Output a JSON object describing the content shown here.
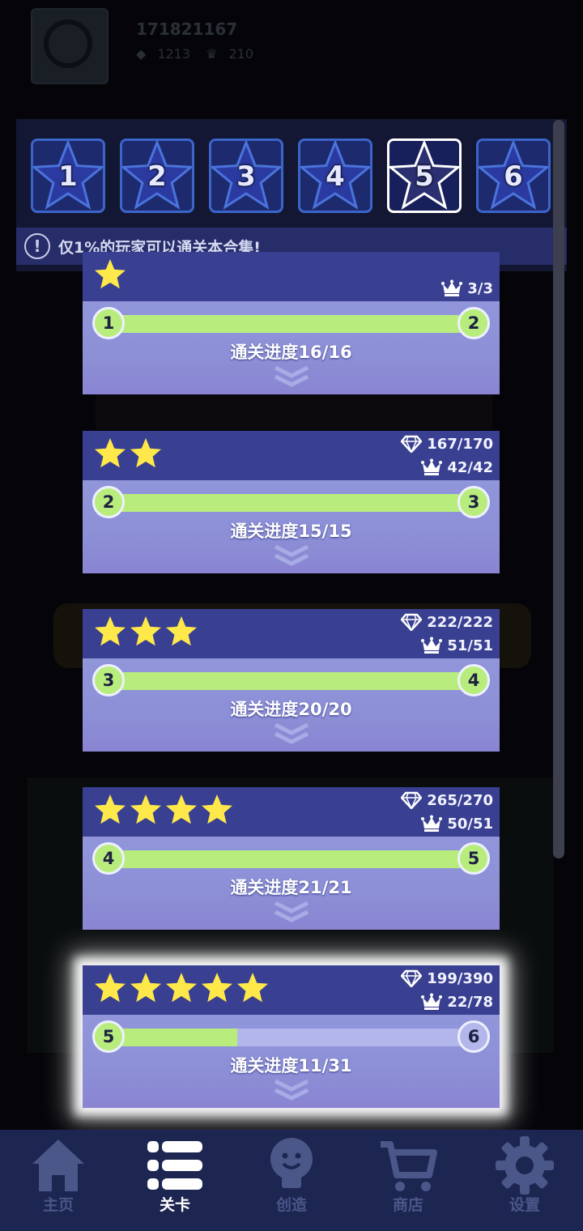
{
  "background": {
    "user_id": "171821167",
    "gems": "1213",
    "crowns": "210"
  },
  "tiers": {
    "selected": "5",
    "items": [
      "1",
      "2",
      "3",
      "4",
      "5",
      "6"
    ]
  },
  "notice": {
    "text": "仅1%的玩家可以通关本合集!"
  },
  "cards": [
    {
      "stars": 1,
      "crowns": "3/3",
      "from": "1",
      "to": "2",
      "progress": "通关进度16/16",
      "fill": 1.0
    },
    {
      "stars": 2,
      "gems": "167/170",
      "crowns": "42/42",
      "from": "2",
      "to": "3",
      "progress": "通关进度15/15",
      "fill": 1.0
    },
    {
      "stars": 3,
      "gems": "222/222",
      "crowns": "51/51",
      "from": "3",
      "to": "4",
      "progress": "通关进度20/20",
      "fill": 1.0
    },
    {
      "stars": 4,
      "gems": "265/270",
      "crowns": "50/51",
      "from": "4",
      "to": "5",
      "progress": "通关进度21/21",
      "fill": 1.0
    },
    {
      "stars": 5,
      "gems": "199/390",
      "crowns": "22/78",
      "from": "5",
      "to": "6",
      "progress": "通关进度11/31",
      "fill": 0.355
    }
  ],
  "nav": {
    "home": "主页",
    "levels": "关卡",
    "create": "创造",
    "shop": "商店",
    "settings": "设置",
    "active": "levels"
  },
  "colors": {
    "progress_fill": "#b8ed7e",
    "star": "#ffe94a",
    "card_header": "#3a4091",
    "card_body": "#8a8fd8",
    "nav_bg": "#1d2551"
  },
  "icons": [
    "alert-icon",
    "star-icon",
    "gem-icon",
    "crown-icon",
    "chevron-down-icon",
    "home-icon",
    "list-icon",
    "lightbulb-icon",
    "cart-icon",
    "gear-icon"
  ]
}
